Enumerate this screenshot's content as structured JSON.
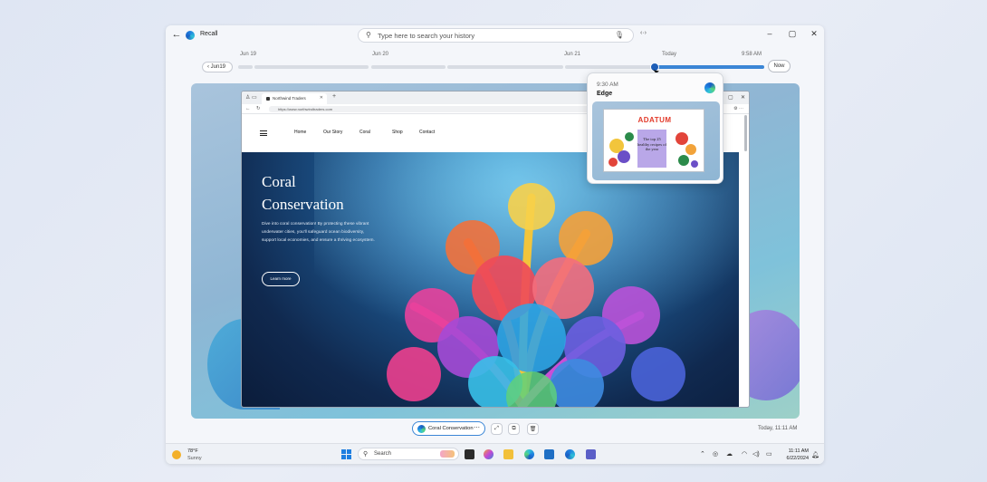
{
  "app": {
    "title": "Recall"
  },
  "search": {
    "placeholder": "Type here to search your history"
  },
  "timeline": {
    "labels": [
      "Jun 19",
      "Jun 20",
      "Jun 21",
      "Today",
      "9:58 AM"
    ],
    "date_button": "Jun19",
    "now_button": "Now",
    "position": 0.56
  },
  "browser": {
    "tab_title": "Northwind Traders",
    "url": "https://www.northwindtraders.com",
    "nav": [
      "Home",
      "Our Story",
      "Coral",
      "Shop",
      "Contact"
    ],
    "hero_title_line1": "Coral",
    "hero_title_line2": "Conservation",
    "hero_body": "Dive into coral conservation! By protecting these vibrant underwater cities, you'll safeguard ocean biodiversity, support local economies, and ensure a thriving ecosystem.",
    "hero_button": "Learn more"
  },
  "popup": {
    "time": "9:30 AM",
    "app": "Edge",
    "thumb_logo": "ADATUM",
    "thumb_card": "The top 25 healthy recipes of the year"
  },
  "toolbar": {
    "chip_label": "Coral Conservation",
    "timestamp": "Today, 11:11 AM"
  },
  "taskbar": {
    "weather_temp": "78°F",
    "weather_cond": "Sunny",
    "search_label": "Search",
    "clock_time": "11:11 AM",
    "clock_date": "6/22/2024"
  },
  "colors": {
    "accent": "#3b86d6",
    "knob": "#1e5fb8",
    "adatum": "#e23a2a"
  },
  "icons": [
    "back-arrow-icon",
    "recall-logo-icon",
    "search-icon",
    "mic-icon",
    "code-icon",
    "minimize-icon",
    "maximize-icon",
    "close-icon",
    "edge-icon",
    "copy-icon",
    "delete-icon",
    "weather-icon",
    "windows-start-icon",
    "wifi-icon",
    "volume-icon",
    "battery-icon",
    "bell-icon"
  ]
}
